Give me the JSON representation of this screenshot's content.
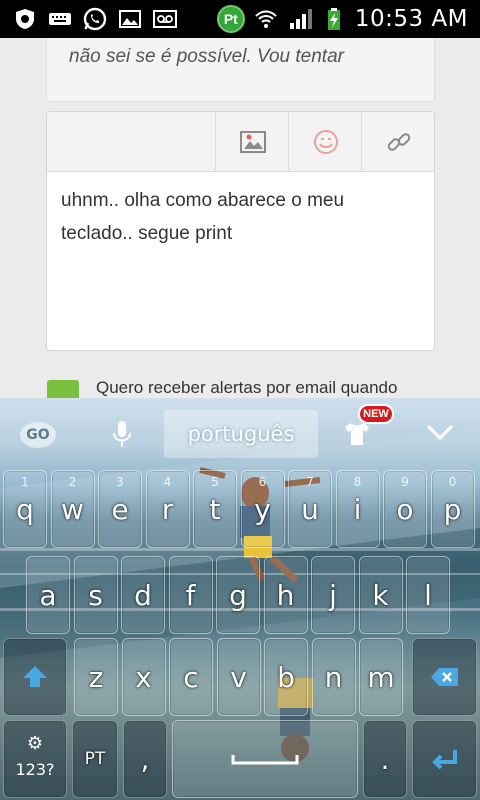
{
  "status_bar": {
    "time": "10:53 AM",
    "badge": "Pt",
    "icons": [
      "shield-icon",
      "keyboard-icon",
      "whatsapp-icon",
      "gallery-icon",
      "voicemail-icon",
      "wifi-icon",
      "signal-icon",
      "battery-charging-icon"
    ]
  },
  "forum": {
    "quote_text": "não sei se é possível. Vou tentar",
    "toolbar_buttons": [
      "image-icon",
      "emoji-icon",
      "link-icon"
    ],
    "reply_lines": [
      "uhnm.. olha como abarece o meu",
      "teclado.. segue print"
    ],
    "checkbox_label": "Quero receber alertas por email quando"
  },
  "keyboard": {
    "go_label": "GO",
    "language": "português",
    "new_badge": "NEW",
    "row1": [
      {
        "ch": "q",
        "num": "1"
      },
      {
        "ch": "w",
        "num": "2"
      },
      {
        "ch": "e",
        "num": "3"
      },
      {
        "ch": "r",
        "num": "4"
      },
      {
        "ch": "t",
        "num": "5"
      },
      {
        "ch": "y",
        "num": "6"
      },
      {
        "ch": "u",
        "num": "7"
      },
      {
        "ch": "i",
        "num": "8"
      },
      {
        "ch": "o",
        "num": "9"
      },
      {
        "ch": "p",
        "num": "0"
      }
    ],
    "row2": [
      "a",
      "s",
      "d",
      "f",
      "g",
      "h",
      "j",
      "k",
      "l"
    ],
    "row3": [
      "z",
      "x",
      "c",
      "v",
      "b",
      "n",
      "m"
    ],
    "key_123": "123?",
    "key_lang": "PT",
    "key_comma": ",",
    "key_period": "."
  },
  "colors": {
    "status_bar": "#000000",
    "badge_green": "#35a63b",
    "checkbox_green": "#7bbf3e",
    "new_red": "#d71920"
  }
}
